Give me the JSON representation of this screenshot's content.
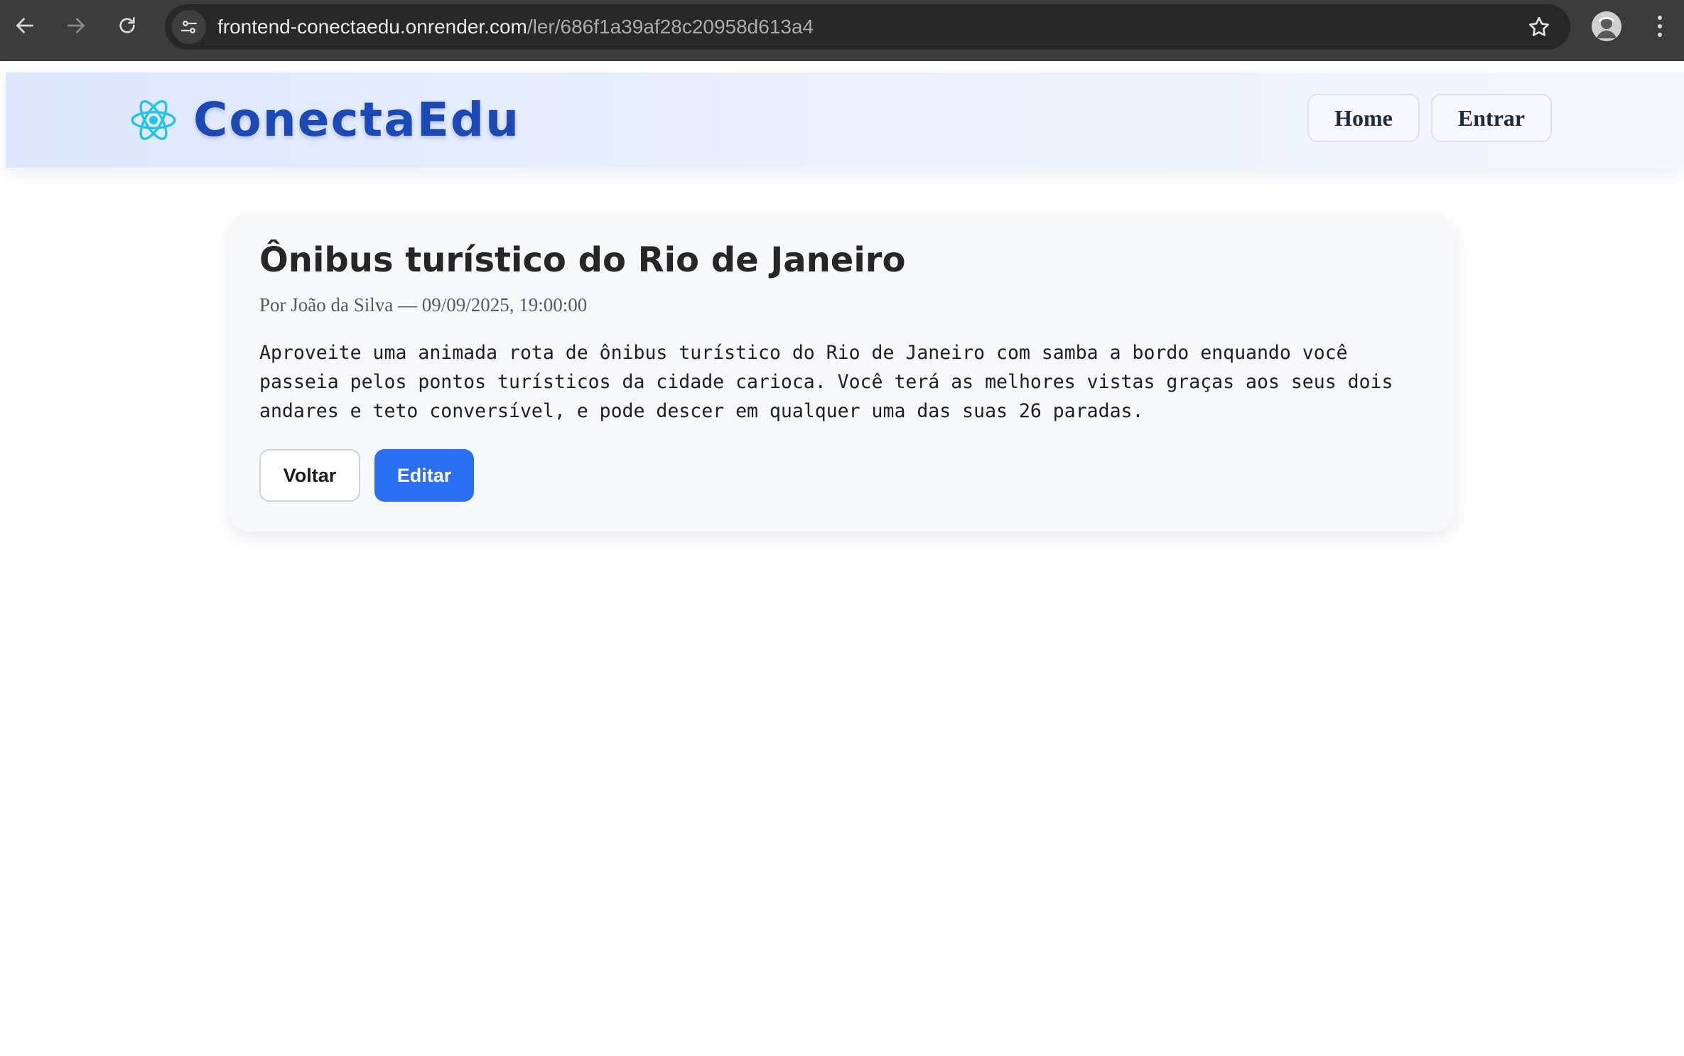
{
  "browser": {
    "url_host": "frontend-conectaedu.onrender.com",
    "url_path": "/ler/686f1a39af28c20958d613a4",
    "icons": {
      "back": "arrow-left-icon",
      "forward": "arrow-right-icon",
      "reload": "reload-icon",
      "site_info": "tune-icon",
      "bookmark": "star-icon",
      "profile": "avatar",
      "menu": "more-vert-icon"
    }
  },
  "header": {
    "brand": "ConectaEdu",
    "logo_icon": "react-atom-icon",
    "nav": {
      "home": "Home",
      "login": "Entrar"
    }
  },
  "post": {
    "title": "Ônibus turístico do Rio de Janeiro",
    "meta": "Por João da Silva — 09/09/2025, 19:00:00",
    "body": "Aproveite uma animada rota de ônibus turístico do Rio de Janeiro com samba a bordo enquando você passeia pelos pontos turísticos da cidade carioca. Você terá as melhores vistas graças aos seus dois andares e teto conversível, e pode descer em qualquer uma das suas 26 paradas.",
    "actions": {
      "back": "Voltar",
      "edit": "Editar"
    }
  },
  "colors": {
    "brand": "#1d49b5",
    "logo": "#22c3e6",
    "primary_button": "#2b6ff3",
    "chrome_bg": "#3c3c3c"
  }
}
